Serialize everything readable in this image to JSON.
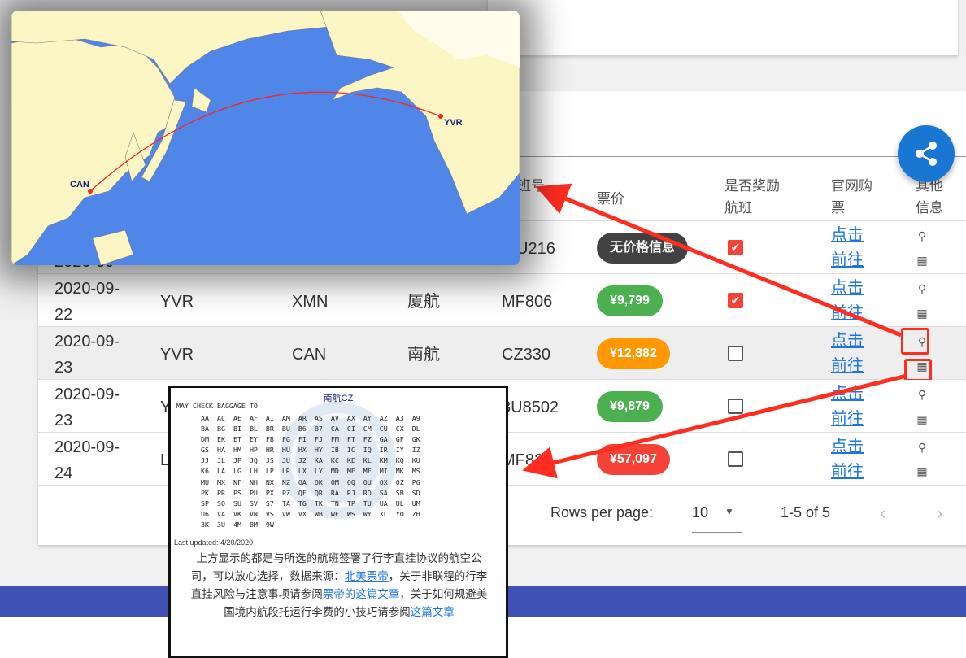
{
  "table": {
    "headers": {
      "flight_no": "班号",
      "price": "票价",
      "reward": "是否奖励航班",
      "official": "官网购票",
      "other": "其他信息"
    },
    "rows": [
      {
        "date": "2020-09-22",
        "origin": "",
        "dest": "",
        "airline": "",
        "flight": "U216",
        "price": "无价格信息",
        "price_color": "#424242",
        "reward": true,
        "link": "点击前往"
      },
      {
        "date": "2020-09-22",
        "origin": "YVR",
        "dest": "XMN",
        "airline": "厦航",
        "flight": "MF806",
        "price": "¥9,799",
        "price_color": "#4caf50",
        "reward": true,
        "link": "点击前往"
      },
      {
        "date": "2020-09-23",
        "origin": "YVR",
        "dest": "CAN",
        "airline": "南航",
        "flight": "CZ330",
        "price": "¥12,882",
        "price_color": "#ff9800",
        "reward": false,
        "link": "点击前往"
      },
      {
        "date": "2020-09-23",
        "origin": "Y",
        "dest": "",
        "airline": "",
        "flight": "3U8502",
        "price": "¥9,879",
        "price_color": "#4caf50",
        "reward": false,
        "link": "点击前往"
      },
      {
        "date": "2020-09-24",
        "origin": "L",
        "dest": "",
        "airline": "",
        "flight": "MF829",
        "price": "¥57,097",
        "price_color": "#f44336",
        "reward": false,
        "link": "点击前往"
      }
    ]
  },
  "pagination": {
    "rows_per_page_label": "Rows per page:",
    "rows_per_page_value": "10",
    "range": "1-5 of 5"
  },
  "map_popup": {
    "origin_label": "CAN",
    "dest_label": "YVR"
  },
  "baggage_popup": {
    "airline_title": "南航CZ",
    "header": "MAY CHECK BAGGAGE TO",
    "codes": "AA  AC  AE  AF  AI  AM  AR  AS  AV  AX  AY  AZ  A3  A9\nBA  BG  BI  BL  BR  BU  B6  B7  CA  CI  CM  CU  CX  DL\nDM  EK  ET  EY  FB  FG  FI  FJ  FM  FT  FZ  GA  GF  GK\nGS  HA  HM  HP  HR  HU  HX  HY  IB  IC  IQ  IR  IY  IZ\nJJ  JL  JP  JQ  JS  JU  J2  KA  KC  KE  KL  KM  KQ  KU\nK6  LA  LG  LH  LP  LR  LX  LY  MD  ME  MF  MI  MK  MS\nMU  MX  NF  NH  NX  NZ  OA  OK  OM  OQ  OU  OX  OZ  PG\nPK  PR  PS  PU  PX  PZ  QF  QR  RA  RJ  RO  SA  SB  SD\nSP  SQ  SU  SV  S7  TA  TG  TK  TN  TP  TU  UA  UL  UM\nU6  VA  VK  VN  VS  VW  VX  WB  WF  WS  WY  XL  YO  ZH\n3K  3U  4M  8M  9W",
    "updated": "Last updated: 4/20/2020",
    "note_1": "上方显示的都是与所选的航班签署了行李直挂协议的航空公司，可以放心选择，数据来源：",
    "note_link_1": "北美票帝",
    "note_2": "，关于非联程",
    "note_3": "的行李直挂风险与注意事项请参阅",
    "note_link_2": "票帝的这篇文章",
    "note_4": "，关于如何规避美国境内航段托运行李费的小技巧请参阅",
    "note_link_3": "这篇文章"
  },
  "colors": {
    "primary": "#1976d2",
    "footer": "#3f51b5",
    "annotation": "#ff2d20"
  }
}
